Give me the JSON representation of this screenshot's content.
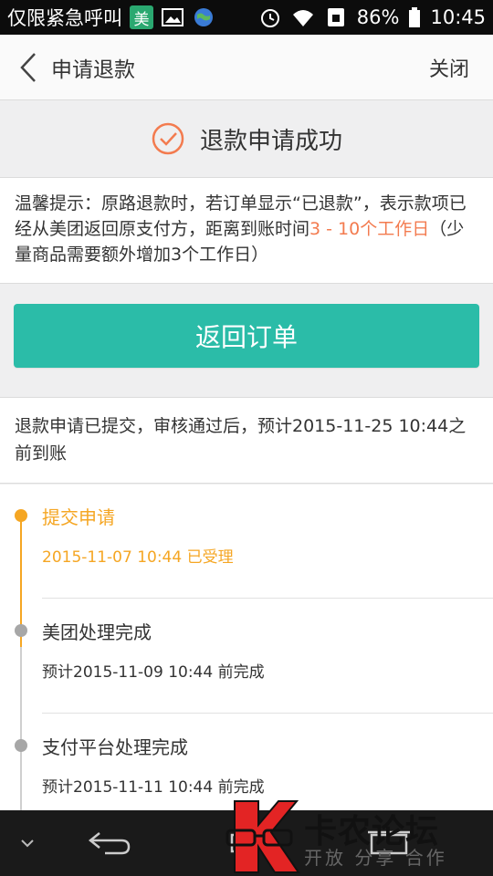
{
  "statusbar": {
    "left_text": "仅限紧急呼叫",
    "badge": "美",
    "battery": "86%",
    "time": "10:45"
  },
  "header": {
    "title": "申请退款",
    "close_label": "关闭"
  },
  "success": {
    "text": "退款申请成功"
  },
  "tip": {
    "prefix": "温馨提示：原路退款时，若订单显示“已退款”，表示款项已经从美团返回原支付方，距离到账时间",
    "highlight": "3 - 10个工作日",
    "suffix": "（少量商品需要额外增加3个工作日）"
  },
  "return_button": {
    "label": "返回订单"
  },
  "info": {
    "text": "退款申请已提交，审核通过后，预计2015-11-25 10:44之前到账"
  },
  "timeline": {
    "steps": [
      {
        "title": "提交申请",
        "sub": "2015-11-07 10:44  已受理",
        "status": "active"
      },
      {
        "title": "美团处理完成",
        "sub": "预计2015-11-09 10:44  前完成",
        "status": "pending"
      },
      {
        "title": "支付平台处理完成",
        "sub": "预计2015-11-11 10:44  前完成",
        "status": "pending"
      }
    ]
  },
  "watermark": {
    "text": "卡农论坛",
    "sub": "开放 分享 合作"
  },
  "colors": {
    "accent_orange": "#f37b4f",
    "timeline_orange": "#f5a623",
    "button_teal": "#2bbca8"
  }
}
